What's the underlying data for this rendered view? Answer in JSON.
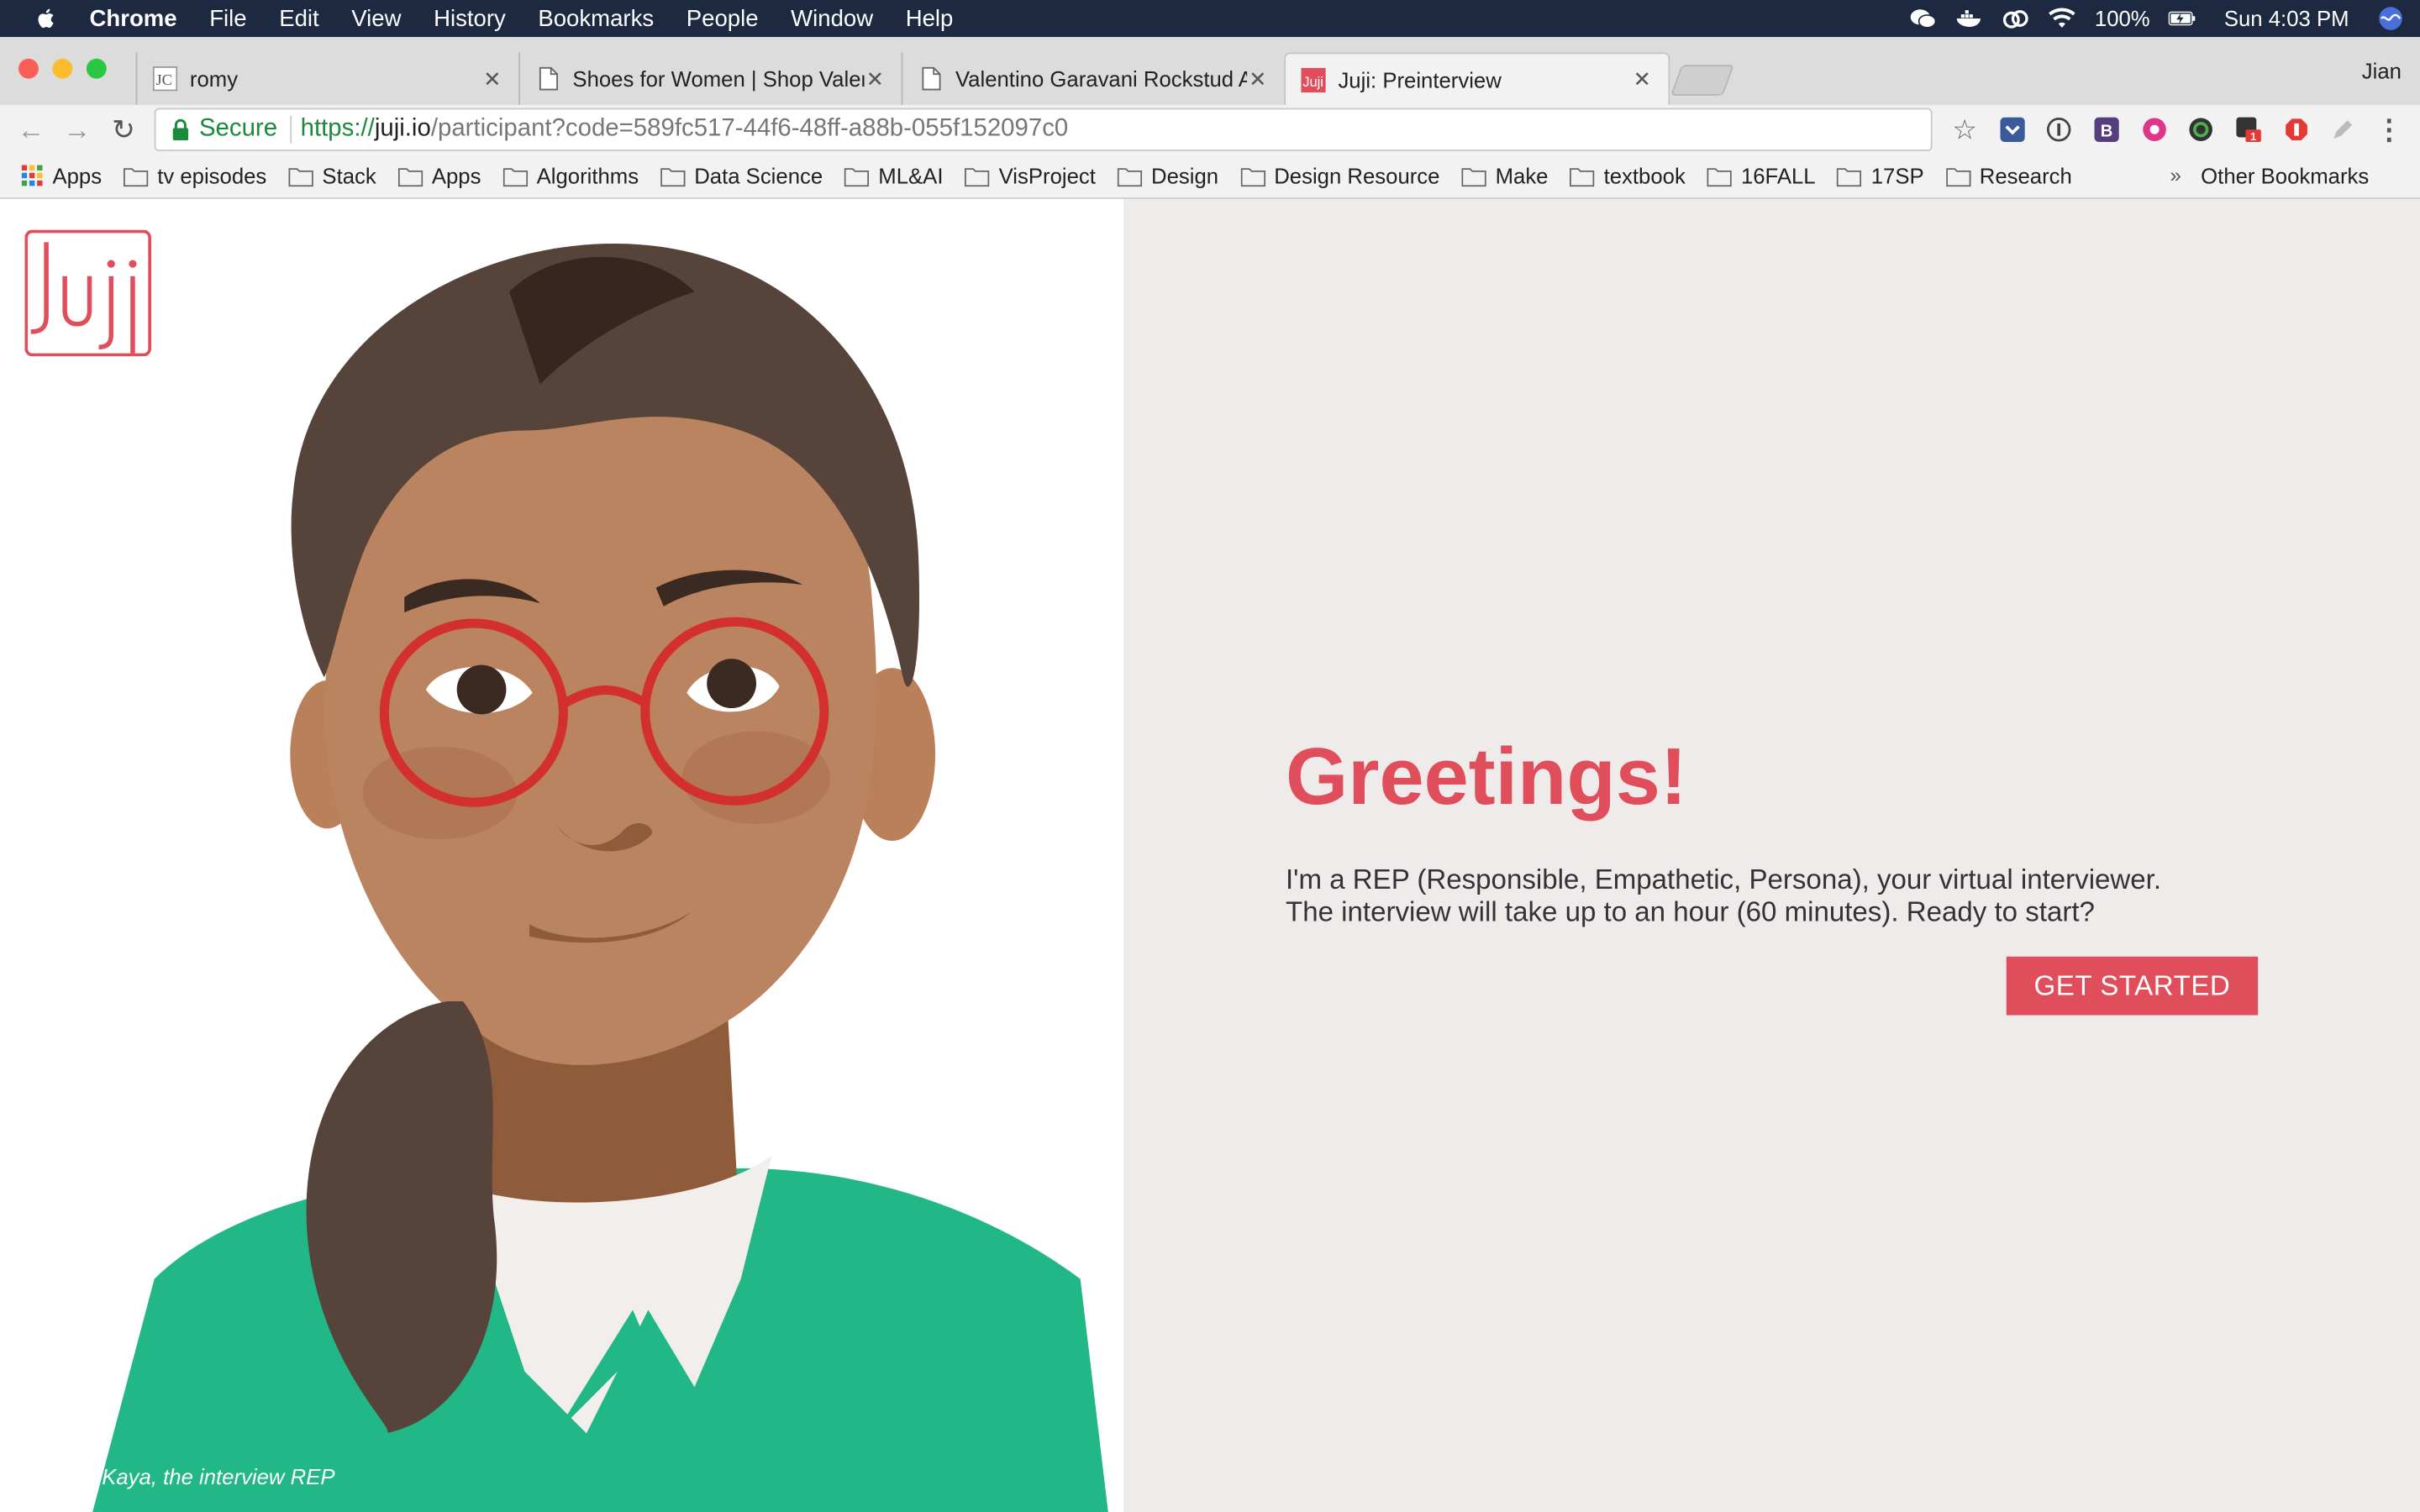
{
  "menubar": {
    "app": "Chrome",
    "items": [
      "File",
      "Edit",
      "View",
      "History",
      "Bookmarks",
      "People",
      "Window",
      "Help"
    ],
    "battery": "100%",
    "clock": "Sun 4:03 PM"
  },
  "tabs": [
    {
      "title": "romy",
      "icon": "jc-favicon-icon"
    },
    {
      "title": "Shoes for Women | Shop Valentino",
      "icon": "page-icon"
    },
    {
      "title": "Valentino Garavani Rockstud Ankle",
      "icon": "page-icon"
    },
    {
      "title": "Juji: Preinterview",
      "icon": "juji-favicon-icon",
      "active": true
    }
  ],
  "profile_name": "Jian",
  "omnibox": {
    "secure_label": "Secure",
    "url_scheme": "https://",
    "url_host": "juji.io",
    "url_path": "/participant?code=589fc517-44f6-48ff-a88b-055f152097c0"
  },
  "bookmarks": {
    "apps_label": "Apps",
    "items": [
      "tv episodes",
      "Stack",
      "Apps",
      "Algorithms",
      "Data Science",
      "ML&AI",
      "VisProject",
      "Design",
      "Design Resource",
      "Make",
      "textbook",
      "16FALL",
      "17SP",
      "Research"
    ],
    "overflow": "»",
    "other": "Other Bookmarks"
  },
  "page": {
    "caption": "Kaya, the interview REP",
    "greeting": "Greetings!",
    "intro_line1": "I'm a REP (Responsible, Empathetic, Persona), your virtual interviewer.",
    "intro_line2": "The interview will take up to an hour (60 minutes). Ready to start?",
    "cta": "GET STARTED",
    "accent_color": "#e04e5c",
    "panel_color": "#efebea"
  }
}
